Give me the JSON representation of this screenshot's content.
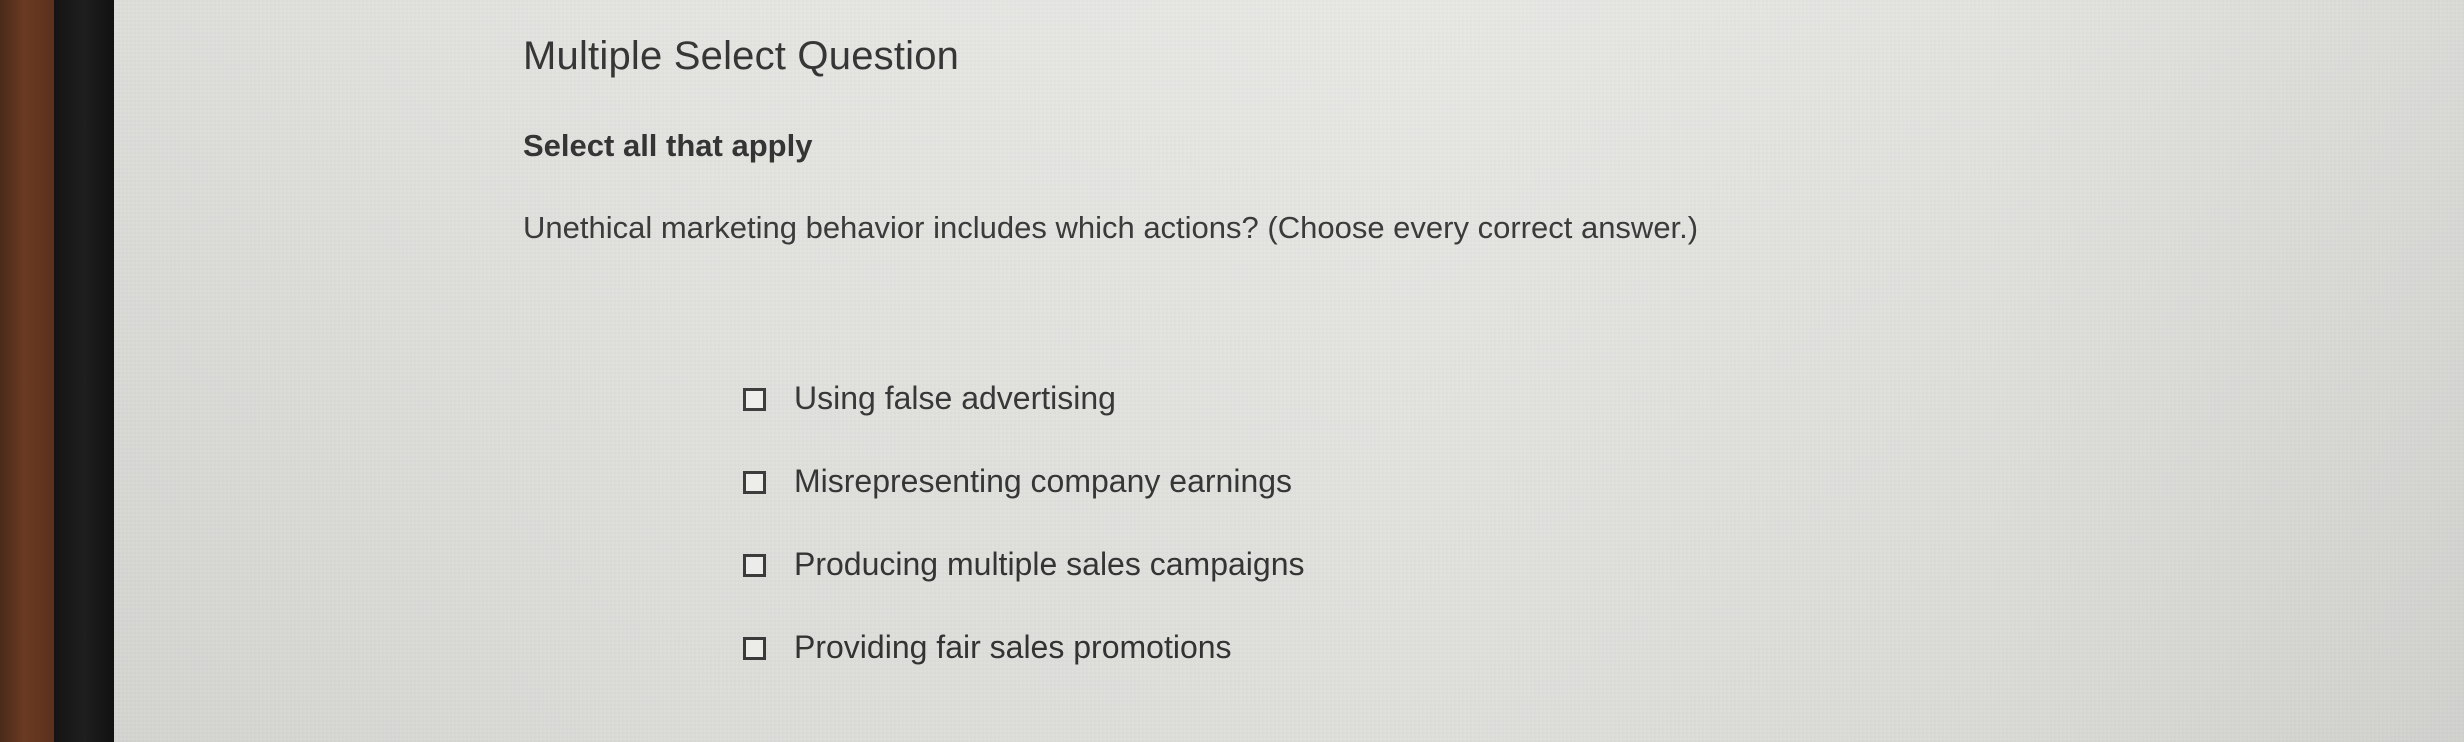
{
  "question": {
    "type_label": "Multiple Select Question",
    "instruction": "Select all that apply",
    "prompt": "Unethical marketing behavior includes which actions? (Choose every correct answer.)"
  },
  "options": [
    {
      "label": "Using false advertising",
      "checked": false
    },
    {
      "label": "Misrepresenting company earnings",
      "checked": false
    },
    {
      "label": "Producing multiple sales campaigns",
      "checked": false
    },
    {
      "label": "Providing fair sales promotions",
      "checked": false
    }
  ],
  "colors": {
    "screen_background": "#e4e4e1",
    "text": "#2b2b2b",
    "checkbox_border": "#3a3a3a"
  }
}
